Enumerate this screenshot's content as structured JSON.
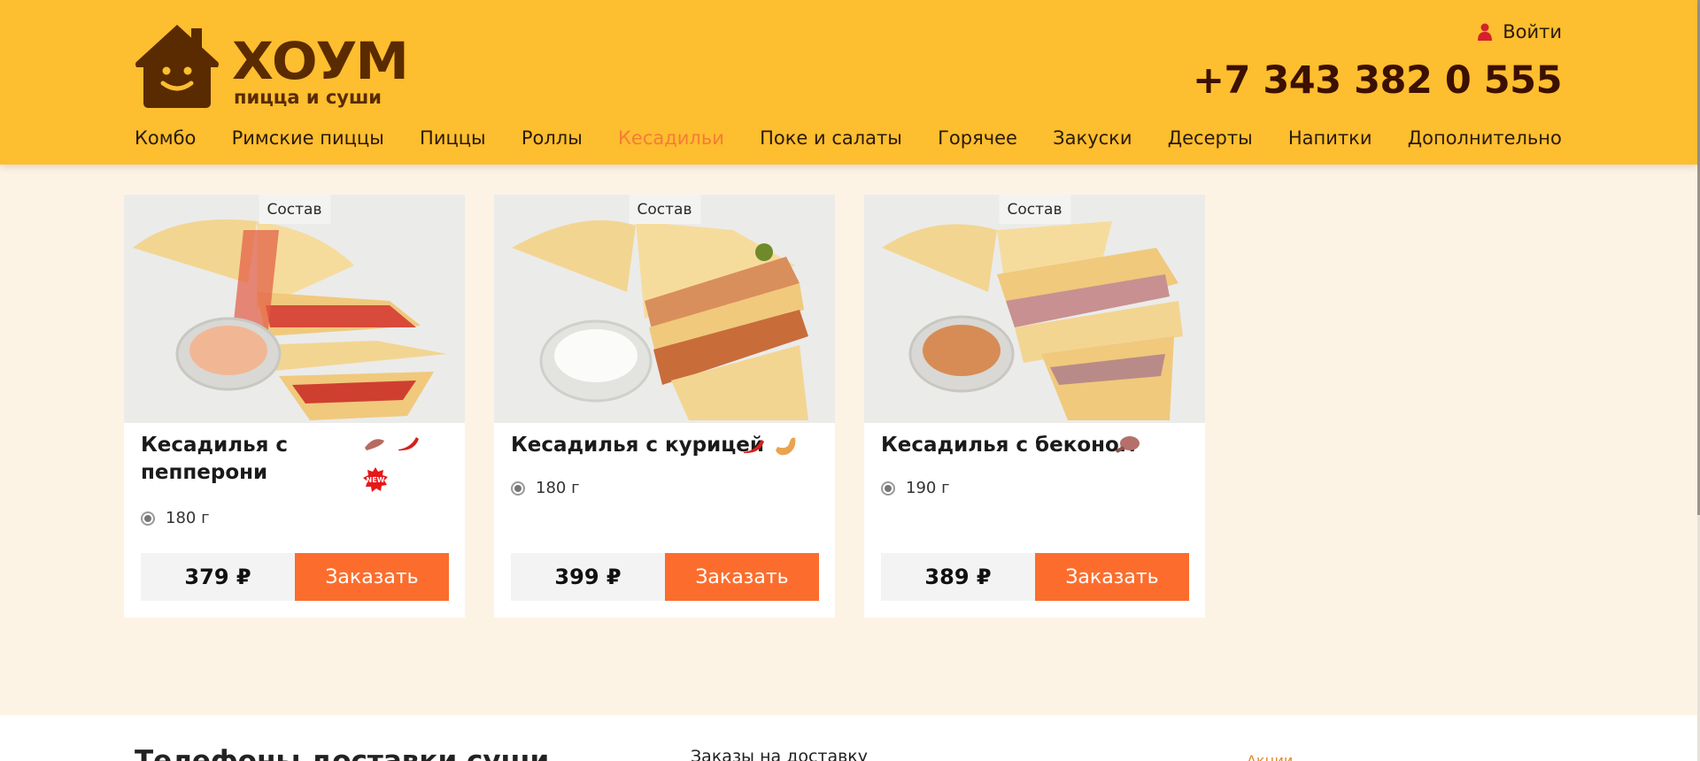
{
  "header": {
    "logo_word": "ХОУМ",
    "logo_sub": "пицца и суши",
    "login_label": "Войти",
    "phone": "+7 343 382 0 555",
    "colors": {
      "background": "#fdbe2f",
      "logo": "#5a2b00",
      "active_nav": "#f47d35"
    }
  },
  "nav": {
    "items": [
      "Комбо",
      "Римские пиццы",
      "Пиццы",
      "Роллы",
      "Кесадильи",
      "Поке и салаты",
      "Горячее",
      "Закуски",
      "Десерты",
      "Напитки",
      "Дополнительно"
    ],
    "active": "Кесадильи"
  },
  "products": [
    {
      "badge": "Состав",
      "title_line1": "Кесадилья с",
      "title_line2": "пепперони",
      "icons": [
        "sausage-icon",
        "chili-pepper-icon",
        "new-badge-icon"
      ],
      "new_label": "NEW",
      "weight": "180 г",
      "price": "379 ₽",
      "order_label": "Заказать"
    },
    {
      "badge": "Состав",
      "title": "Кесадилья с курицей",
      "icons": [
        "chili-pepper-icon",
        "chicken-icon"
      ],
      "weight": "180 г",
      "price": "399 ₽",
      "order_label": "Заказать"
    },
    {
      "badge": "Состав",
      "title": "Кесадилья с беконом",
      "icons": [
        "meat-leg-icon"
      ],
      "weight": "190 г",
      "price": "389 ₽",
      "order_label": "Заказать"
    }
  ],
  "colors": {
    "page_bg": "#fdf3e5",
    "order_button": "#fc6d2d",
    "price_bg": "#f3f3f3"
  },
  "footer": {
    "col1": "Телефоны доставки суши",
    "col2": "Заказы на доставку",
    "col3": "Акции"
  }
}
